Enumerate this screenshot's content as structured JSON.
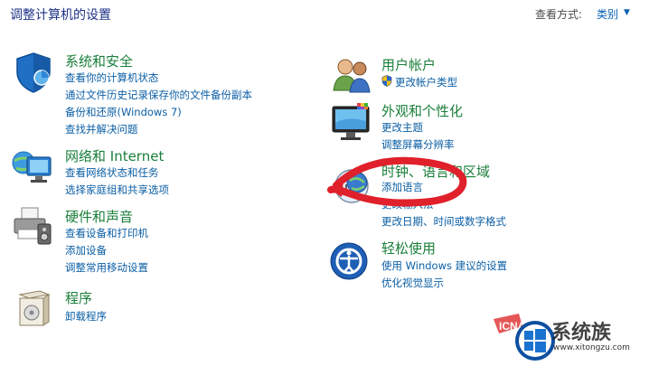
{
  "header": {
    "title": "调整计算机的设置",
    "view_by_label": "查看方式:",
    "view_by_value": "类别"
  },
  "left_categories": [
    {
      "title": "系统和安全",
      "icon": "system-security-shield-icon",
      "links": [
        "查看你的计算机状态",
        "通过文件历史记录保存你的文件备份副本",
        "备份和还原(Windows 7)",
        "查找并解决问题"
      ]
    },
    {
      "title": "网络和 Internet",
      "icon": "network-globe-icon",
      "links": [
        "查看网络状态和任务",
        "选择家庭组和共享选项"
      ]
    },
    {
      "title": "硬件和声音",
      "icon": "printer-icon",
      "links": [
        "查看设备和打印机",
        "添加设备",
        "调整常用移动设置"
      ]
    },
    {
      "title": "程序",
      "icon": "programs-box-icon",
      "links": [
        "卸载程序"
      ]
    }
  ],
  "right_categories": [
    {
      "title": "用户帐户",
      "icon": "users-icon",
      "links": [
        "更改帐户类型"
      ]
    },
    {
      "title": "外观和个性化",
      "icon": "monitor-icon",
      "links": [
        "更改主题",
        "调整屏幕分辨率"
      ]
    },
    {
      "title": "时钟、语言和区域",
      "icon": "clock-globe-icon",
      "links": [
        "添加语言",
        "更改输入法",
        "更改日期、时间或数字格式"
      ]
    },
    {
      "title": "轻松使用",
      "icon": "ease-of-access-icon",
      "links": [
        "使用 Windows 建议的设置",
        "优化视觉显示"
      ]
    }
  ],
  "watermark": {
    "brand": "系统族",
    "url": "www.xitongzu.com"
  },
  "colors": {
    "title_green": "#1a7f3a",
    "link_blue": "#0b5fa5",
    "header_blue": "#1e3287",
    "annotation_red": "#e0202a"
  }
}
